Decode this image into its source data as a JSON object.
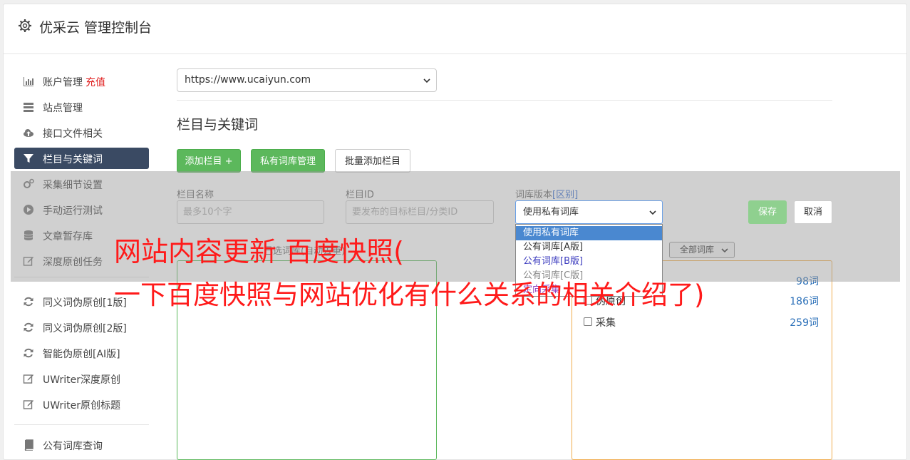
{
  "app": {
    "title": "优采云 管理控制台"
  },
  "sidebar": {
    "items": [
      {
        "label": "账户管理",
        "extra": "充值",
        "icon": "bar-chart-icon"
      },
      {
        "label": "站点管理",
        "icon": "server-icon"
      },
      {
        "label": "接口文件相关",
        "icon": "cloud-upload-icon"
      },
      {
        "label": "栏目与关键词",
        "icon": "filter-icon",
        "active": true
      },
      {
        "label": "采集细节设置",
        "icon": "cogs-icon"
      },
      {
        "label": "手动运行测试",
        "icon": "play-circle-icon"
      },
      {
        "label": "文章暂存库",
        "icon": "database-icon"
      },
      {
        "label": "深度原创任务",
        "icon": "edit-icon"
      },
      {
        "label": "同义词伪原创[1版]",
        "icon": "refresh-icon"
      },
      {
        "label": "同义词伪原创[2版]",
        "icon": "refresh-icon"
      },
      {
        "label": "智能伪原创[AI版]",
        "icon": "refresh-icon"
      },
      {
        "label": "UWriter深度原创",
        "icon": "edit-icon"
      },
      {
        "label": "UWriter原创标题",
        "icon": "edit-icon"
      },
      {
        "label": "公有词库查询",
        "icon": "book-icon"
      }
    ]
  },
  "main": {
    "site_select": "https://www.ucaiyun.com",
    "section_title": "栏目与关键词",
    "buttons": {
      "add_column": "添加栏目 +",
      "private_lib": "私有词库管理",
      "batch_add": "批量添加栏目"
    },
    "form": {
      "name_label": "栏目名称",
      "name_placeholder": "最多10个字",
      "id_label": "栏目ID",
      "id_placeholder": "要发布的目标栏目/分类ID",
      "version_label": "词库版本",
      "version_link": "[区别]",
      "version_value": "使用私有词库",
      "version_options": [
        "使用私有词库",
        "公有词库[A版]",
        "公有词库[B版]",
        "公有词库[C版]",
        "定向采集"
      ],
      "save": "保存",
      "cancel": "取消"
    },
    "hint": "已选词库(自动去重)",
    "all_libs": "全部词库",
    "libs": [
      {
        "name": "",
        "count": "98词"
      },
      {
        "name": "伪原创",
        "count": "186词"
      },
      {
        "name": "采集",
        "count": "259词"
      }
    ]
  },
  "watermark": {
    "line1": "网站内容更新 百度快照(",
    "line2": "一下百度快照与网站优化有什么关系的相关介绍了)"
  },
  "colors": {
    "active_nav": "#3a4a63",
    "green": "#5cb85c",
    "orange": "#f0ad4e",
    "watermark": "#ff1a1a"
  }
}
